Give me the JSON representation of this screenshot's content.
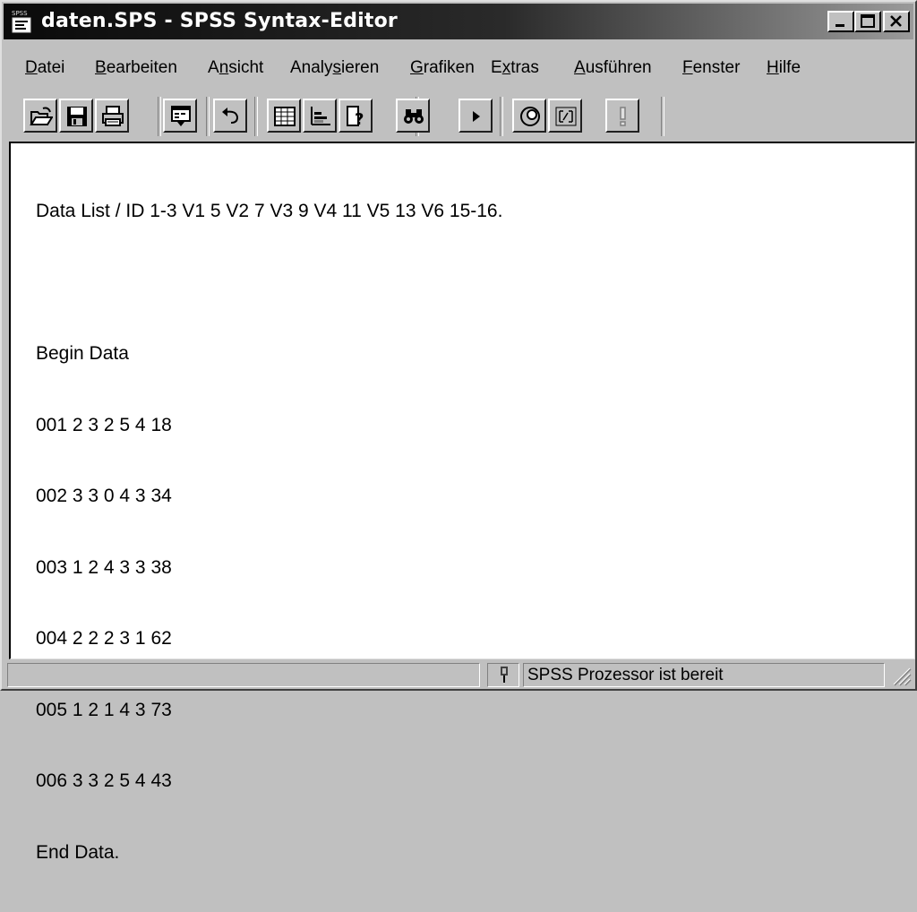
{
  "window": {
    "title": "daten.SPS - SPSS Syntax-Editor",
    "icon_label": "SPSS"
  },
  "menu": [
    {
      "label": "Datei",
      "accel": "D",
      "rest": "atei"
    },
    {
      "label": "Bearbeiten",
      "accel": "B",
      "rest": "earbeiten"
    },
    {
      "label": "Ansicht",
      "pre": "A",
      "accel": "n",
      "rest": "sicht"
    },
    {
      "label": "Analysieren",
      "pre": "Analy",
      "accel": "s",
      "rest": "ieren"
    },
    {
      "label": "Grafiken",
      "accel": "G",
      "rest": "rafiken"
    },
    {
      "label": "Extras",
      "pre": "E",
      "accel": "x",
      "rest": "tras"
    },
    {
      "label": "Ausführen",
      "accel": "A",
      "rest": "usführen"
    },
    {
      "label": "Fenster",
      "accel": "F",
      "rest": "enster"
    },
    {
      "label": "Hilfe",
      "accel": "H",
      "rest": "ilfe"
    }
  ],
  "toolbar": [
    {
      "icon": "open-folder-icon"
    },
    {
      "icon": "save-disk-icon"
    },
    {
      "icon": "printer-icon"
    },
    {
      "icon": "dialog-recall-icon"
    },
    {
      "icon": "undo-icon"
    },
    {
      "icon": "goto-data-icon"
    },
    {
      "icon": "goto-chart-icon"
    },
    {
      "icon": "variables-icon"
    },
    {
      "icon": "find-binoculars-icon"
    },
    {
      "icon": "run-icon"
    },
    {
      "icon": "use-sets-icon"
    },
    {
      "icon": "value-labels-icon"
    },
    {
      "icon": "designate-window-icon"
    }
  ],
  "editor": {
    "lines": [
      "Data List / ID 1-3 V1 5 V2 7 V3 9 V4 11 V5 13 V6 15-16.",
      "",
      "Begin Data",
      "001 2 3 2 5 4 18",
      "002 3 3 0 4 3 34",
      "003 1 2 4 3 3 38",
      "004 2 2 2 3 1 62",
      "005 1 2 1 4 3 73",
      "006 3 3 2 5 4 43",
      "End Data."
    ]
  },
  "statusbar": {
    "text": "SPSS Prozessor  ist bereit"
  },
  "colors": {
    "face": "#c0c0c0",
    "title_left": "#0a0a0a",
    "title_right": "#9a9a9a"
  }
}
